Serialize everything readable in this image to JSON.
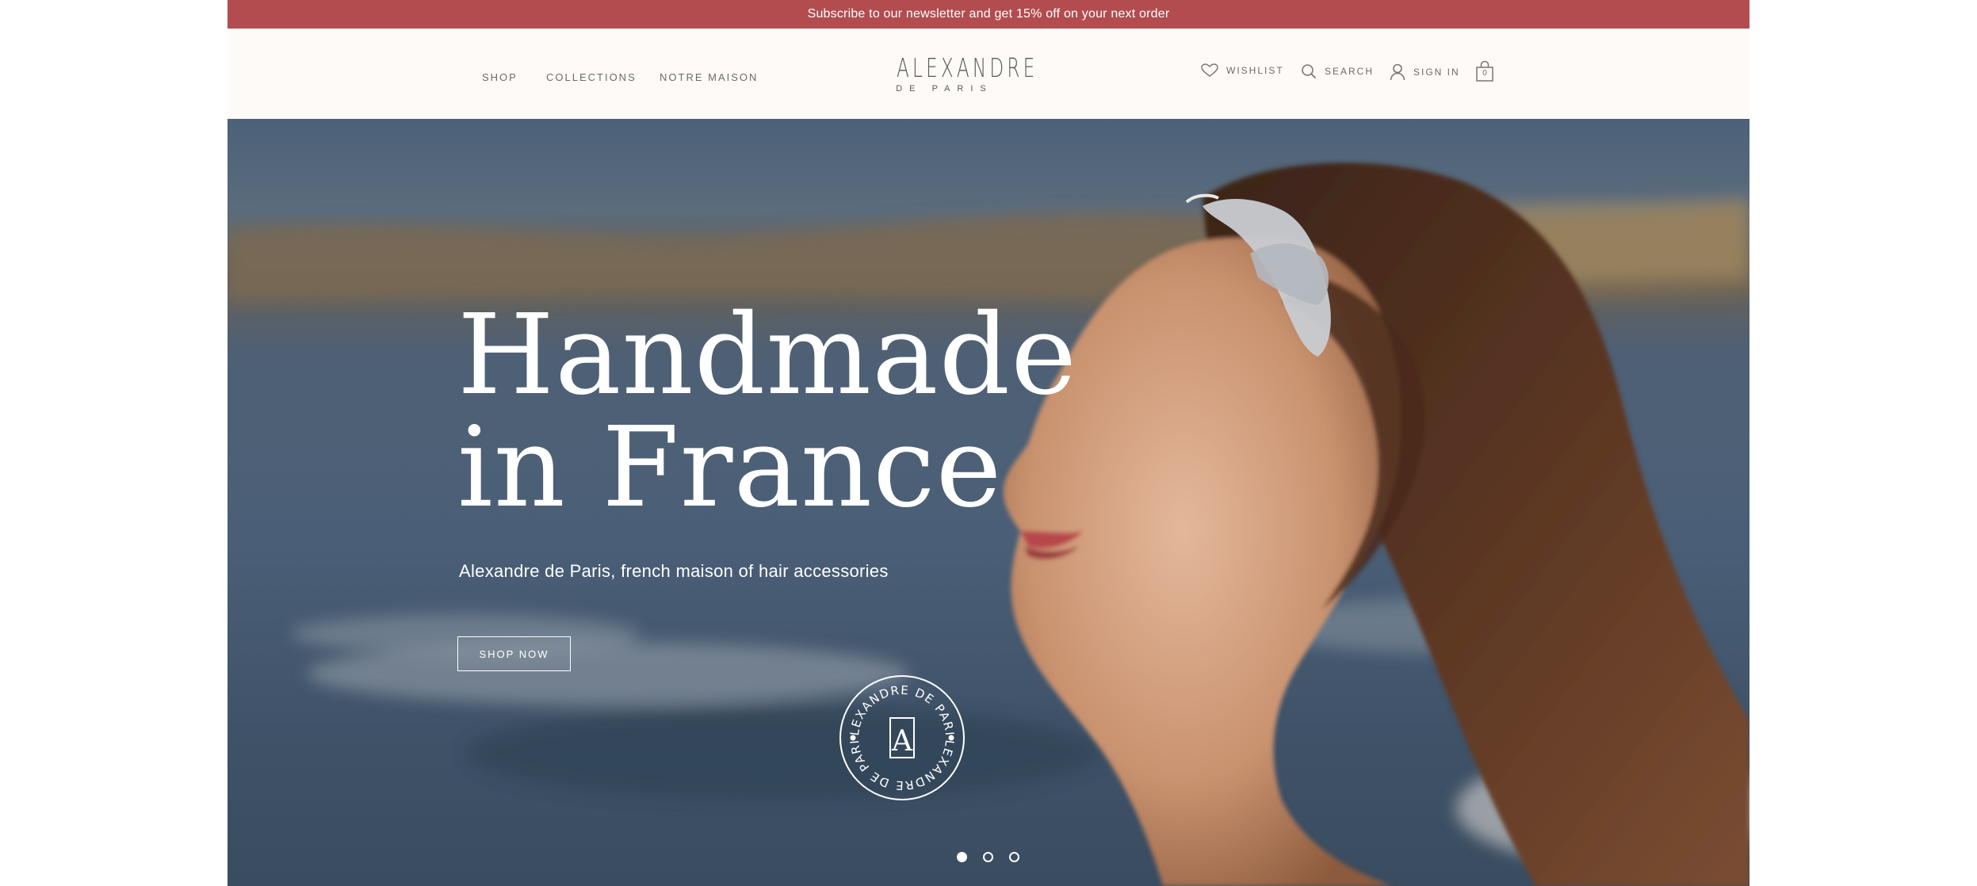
{
  "promo": {
    "text": "Subscribe to our newsletter and get 15% off on your next order",
    "background": "#b24c4f"
  },
  "nav": {
    "items": [
      {
        "label": "SHOP"
      },
      {
        "label": "COLLECTIONS"
      },
      {
        "label": "NOTRE MAISON"
      }
    ]
  },
  "logo": {
    "main": "ALEXANDRE",
    "sub": "DE PARIS"
  },
  "utility": {
    "wishlist": {
      "label": "WISHLIST",
      "icon": "heart-icon"
    },
    "search": {
      "label": "SEARCH",
      "icon": "search-icon"
    },
    "sign_in": {
      "label": "SIGN IN",
      "icon": "user-icon"
    },
    "cart": {
      "count": "0",
      "icon": "bag-icon"
    }
  },
  "hero": {
    "title": "Handmade\nin France",
    "subtitle": "Alexandre de Paris, french maison of hair accessories",
    "cta": "SHOP NOW",
    "seal_text": "ALEXANDRE DE PARIS",
    "seal_letter": "A",
    "slides": {
      "count": 3,
      "active": 1
    }
  }
}
